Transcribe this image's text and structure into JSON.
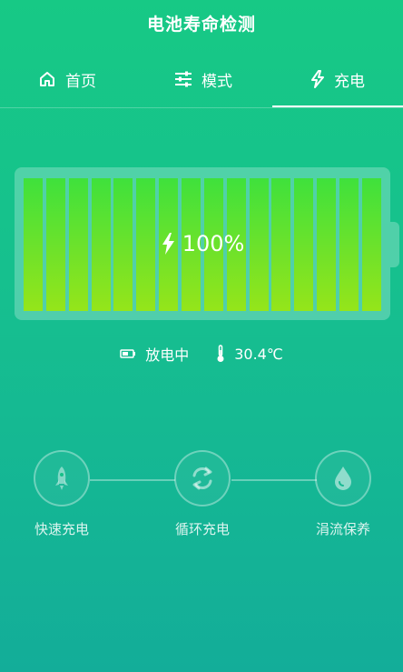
{
  "app": {
    "title": "电池寿命检测"
  },
  "tabs": [
    {
      "label": "首页",
      "icon": "home-icon"
    },
    {
      "label": "模式",
      "icon": "sliders-icon"
    },
    {
      "label": "充电",
      "icon": "lightning-icon",
      "active": true
    }
  ],
  "battery": {
    "level_text": "100%",
    "level_fraction": 1.0,
    "cell_count": 16,
    "icon": "lightning-icon"
  },
  "status": {
    "state": "放电中",
    "state_icon": "battery-icon",
    "temperature": "30.4℃",
    "temperature_icon": "thermometer-icon"
  },
  "modes": [
    {
      "label": "快速充电",
      "icon": "rocket-icon"
    },
    {
      "label": "循环充电",
      "icon": "cycle-icon"
    },
    {
      "label": "涓流保养",
      "icon": "droplet-icon"
    }
  ],
  "colors": {
    "background_top": "#17c985",
    "background_bottom": "#13ad99",
    "cell_top": "#3fe13c",
    "cell_bottom": "#95e51a"
  }
}
